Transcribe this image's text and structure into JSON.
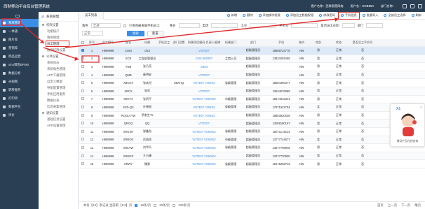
{
  "app": {
    "title": "西财移动平台后台管理系统",
    "top_info": [
      "客户名称：西财恩营网络",
      "用户名：GOB55X",
      "部门名称：",
      "设置"
    ]
  },
  "sidebar": {
    "items": [
      {
        "label": "系统管理",
        "active": true
      },
      {
        "label": "一体通"
      },
      {
        "label": "图片库"
      },
      {
        "label": "营销库"
      },
      {
        "label": "跨品运营"
      },
      {
        "label": "xino销售BPMS"
      },
      {
        "label": "数据分析"
      },
      {
        "label": "光视图"
      },
      {
        "label": "转移服务"
      },
      {
        "label": "打印项"
      },
      {
        "label": "数据平台"
      },
      {
        "label": "评价"
      }
    ]
  },
  "subnav": {
    "header": "系统管理",
    "sections": [
      {
        "group": "权限设置",
        "items": [
          "功能账户",
          "角色管理",
          "员工管理",
          "数据权限设置"
        ],
        "selected": "员工管理"
      },
      {
        "group": "公共设置",
        "items": [
          "系统日志",
          "系统角色管理",
          "APP下载管理",
          "自定义模版",
          "导航配置管理",
          "手机应用服务",
          "数据仪表",
          "信息采集管理"
        ]
      },
      {
        "group": "通知设置",
        "items": [
          "基础信息设置",
          "APP设置管理"
        ]
      }
    ]
  },
  "main": {
    "tab_label": "员工列表",
    "toolbar": [
      {
        "label": "新增"
      },
      {
        "label": "删除"
      },
      {
        "label": "添加操作权限"
      },
      {
        "label": "添加员工数据权限"
      },
      {
        "label": "修改密码"
      },
      {
        "label": "手机信息",
        "highlight": true
      },
      {
        "label": "批量导入"
      },
      {
        "label": "全部员工选择"
      },
      {
        "label": "刷新"
      }
    ],
    "filters": {
      "row1": {
        "label1": "角色",
        "select1": "全部",
        "check_label": "只查询被关联手机员工",
        "check_on": false,
        "label2": "姓名",
        "label3": "电话",
        "label4": "工号",
        "label5": "",
        "label6": "手机号",
        "label7": "是否员工在职",
        "label8": "部门",
        "label9": ""
      },
      "row2": {
        "select": "正常",
        "search_btn": "搜索",
        "reset_btn": "重置"
      }
    },
    "table": {
      "columns": [
        "",
        "序号",
        "员工编号",
        "姓名",
        "所属",
        "手机员工",
        "部门设置",
        "所属项目编码 负责人编辑",
        "所属部门",
        "部门",
        "手机",
        "城市",
        "性别",
        "状态",
        "是否员工手机号"
      ],
      "rows": [
        {
          "id": "1",
          "code": "H999998",
          "name": "CHUI",
          "org": "chui",
          "m": "",
          "dep": "",
          "proj": "VOTE07",
          "projlink": true,
          "pd": "",
          "dept": "超级管理员",
          "phone": "18888723778",
          "city": "HW",
          "sex": "男",
          "status": "正常",
          "extra": "否",
          "hl": true
        },
        {
          "id": "2",
          "code": "H999998",
          "name": "SCB",
          "org": "工程部管理员",
          "m": "",
          "dep": "",
          "proj": "SOS B00307",
          "projlink": true,
          "pd": "工商入员",
          "dept": "超级管理员",
          "phone": "13823204455",
          "city": "HW",
          "sex": "男",
          "status": "正常",
          "extra": "否"
        },
        {
          "id": "3",
          "code": "H999998",
          "name": "YNB",
          "org": "张乃亮",
          "m": "",
          "dep": "",
          "proj": "SB03",
          "projlink": true,
          "pd": "",
          "dept": "超级管理员",
          "phone": "",
          "city": "HW",
          "sex": "男",
          "status": "正常",
          "extra": "否"
        },
        {
          "id": "4",
          "code": "H999998",
          "name": "QMB",
          "org": "秦明安",
          "m": "",
          "dep": "",
          "proj": "VOTE07",
          "projlink": true,
          "pd": "",
          "dept": "超级管理员",
          "phone": "",
          "city": "HW",
          "sex": "男",
          "status": "正常",
          "extra": "否"
        },
        {
          "id": "5",
          "code": "H999998",
          "name": "XBCHX",
          "org": "张欢恒",
          "m": "",
          "dep": "XBXHQ",
          "proj": "VOTE07 VOMX2",
          "projlink": true,
          "pd": "省级管理",
          "dept": "超级管理员",
          "phone": "18584490377",
          "city": "HW",
          "sex": "男",
          "status": "正常",
          "extra": "否"
        },
        {
          "id": "6",
          "code": "H999998",
          "name": "XBCX",
          "org": "张欢",
          "m": "",
          "dep": "",
          "proj": "VOTE07",
          "projlink": true,
          "pd": "",
          "dept": "超级管理员",
          "phone": "13634076985",
          "city": "HW",
          "sex": "男",
          "status": "正常",
          "extra": "否"
        },
        {
          "id": "7",
          "code": "H999998",
          "name": "XBCTX",
          "org": "张丙平",
          "m": "",
          "dep": "",
          "proj": "VOTE07 VOMX02",
          "projlink": true,
          "pd": "市级管理",
          "dept": "超级管理员",
          "phone": "18574012341",
          "city": "HW",
          "sex": "男",
          "status": "正常",
          "extra": "否"
        },
        {
          "id": "8",
          "code": "H999998",
          "name": "SFD-QX",
          "org": "叶晓丽",
          "m": "",
          "dep": "",
          "proj": "VOTE07 VOMX2",
          "projlink": true,
          "pd": "省级管理",
          "dept": "超级管理员",
          "phone": "17971922754",
          "city": "HW",
          "sex": "女",
          "status": "正常",
          "extra": "否"
        },
        {
          "id": "9",
          "code": "H999998",
          "name": "ROOLVTW",
          "org": "罗俊生Tx",
          "m": "",
          "dep": "",
          "proj": "VOTE07 VOMX2",
          "projlink": true,
          "pd": "",
          "dept": "超级管理员",
          "phone": "18893920038",
          "city": "HW",
          "sex": "男",
          "status": "正常",
          "extra": "否"
        },
        {
          "id": "10",
          "code": "H999998",
          "name": "QRGQ",
          "org": "QQ",
          "m": "",
          "dep": "",
          "proj": "VOTE07",
          "projlink": true,
          "pd": "",
          "dept": "超级管理员",
          "phone": "13058180187",
          "city": "HW",
          "sex": "男",
          "status": "正常",
          "extra": "否"
        },
        {
          "id": "11",
          "code": "H999998",
          "name": "XRGXH",
          "org": "邹鑫浩",
          "m": "",
          "dep": "",
          "proj": "VOTE07 VOMX02",
          "projlink": true,
          "pd": "省级管理",
          "dept": "超级管理员",
          "phone": "15071172514",
          "city": "HW",
          "sex": "男",
          "status": "正常",
          "extra": "否"
        },
        {
          "id": "12",
          "code": "H999998",
          "name": "XRMOX",
          "org": "肖雨欣",
          "m": "",
          "dep": "",
          "proj": "VOTE07 VOMX02",
          "projlink": true,
          "pd": "市级管理",
          "dept": "超级管理员",
          "phone": "13777744677",
          "city": "HW",
          "sex": "女",
          "status": "正常",
          "extra": "否"
        },
        {
          "id": "13",
          "code": "H999998",
          "name": "XRLHW",
          "org": "刘华兵",
          "m": "",
          "dep": "",
          "proj": "VOTE07 VOMX02",
          "projlink": true,
          "pd": "省级管理",
          "dept": "超级管理员",
          "phone": "13677769948",
          "city": "HW",
          "sex": "男",
          "status": "正常",
          "extra": "否"
        },
        {
          "id": "14",
          "code": "H999998",
          "name": "XRWXF",
          "org": "王小峰",
          "m": "",
          "dep": "",
          "proj": "VOTE07 VOMX02",
          "projlink": true,
          "pd": "",
          "dept": "超级管理员",
          "phone": "13377720800",
          "city": "HW",
          "sex": "男",
          "status": "正常",
          "extra": "否"
        },
        {
          "id": "15",
          "code": "H999998",
          "name": "XRWY",
          "org": "魏勇",
          "m": "",
          "dep": "",
          "proj": "VOTE07 VOMX02",
          "projlink": true,
          "pd": "省级管理",
          "dept": "超级管理员",
          "phone": "18175269743",
          "city": "HW",
          "sex": "男",
          "status": "正常",
          "extra": "否"
        }
      ]
    },
    "pager": {
      "summary": "共有【24】条记录 当前第【1/2】页",
      "page_size": "15条/页",
      "size_opts": [
        "20条/页",
        "100条/页"
      ],
      "nav": [
        "首页",
        "上一页",
        "下一页",
        "尾页"
      ]
    }
  },
  "popup": {
    "brand": "X1",
    "close": "×",
    "caption": "移动产品在线咨询"
  },
  "colors": {
    "accent": "#3a8ee6",
    "sidebar": "#2a3f54",
    "annotation": "#e02a2a"
  }
}
